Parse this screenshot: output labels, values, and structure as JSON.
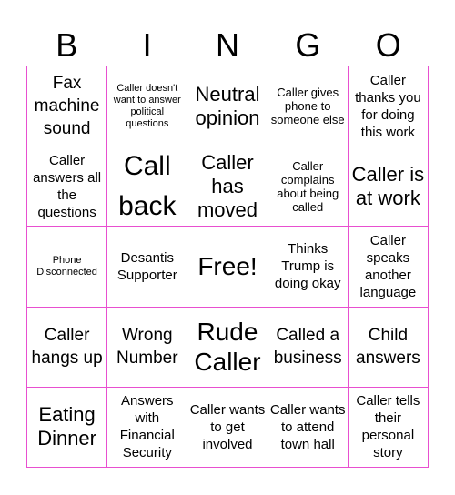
{
  "header": {
    "letters": [
      "B",
      "I",
      "N",
      "G",
      "O"
    ]
  },
  "border_color": "#e84fd0",
  "cells": [
    {
      "text": "Fax machine sound",
      "size": "s-lg"
    },
    {
      "text": "Caller doesn't want to answer political questions",
      "size": "s-xs"
    },
    {
      "text": "Neutral opinion",
      "size": "s-xl"
    },
    {
      "text": "Caller gives phone to someone else",
      "size": "s-sm"
    },
    {
      "text": "Caller thanks you for doing this work",
      "size": "s-md"
    },
    {
      "text": "Caller answers all the questions",
      "size": "s-md"
    },
    {
      "text": "Call back",
      "size": "s-huge"
    },
    {
      "text": "Caller has moved",
      "size": "s-xl"
    },
    {
      "text": "Caller complains about being called",
      "size": "s-sm"
    },
    {
      "text": "Caller is at work",
      "size": "s-xl"
    },
    {
      "text": "Phone Disconnected",
      "size": "s-xs"
    },
    {
      "text": "Desantis Supporter",
      "size": "s-md"
    },
    {
      "text": "Free!",
      "size": "s-xxl"
    },
    {
      "text": "Thinks Trump is doing okay",
      "size": "s-md"
    },
    {
      "text": "Caller speaks another language",
      "size": "s-md"
    },
    {
      "text": "Caller hangs up",
      "size": "s-lg"
    },
    {
      "text": "Wrong Number",
      "size": "s-lg"
    },
    {
      "text": "Rude Caller",
      "size": "s-xxl"
    },
    {
      "text": "Called a business",
      "size": "s-lg"
    },
    {
      "text": "Child answers",
      "size": "s-lg"
    },
    {
      "text": "Eating Dinner",
      "size": "s-xl"
    },
    {
      "text": "Answers with Financial Security",
      "size": "s-md"
    },
    {
      "text": "Caller wants to get involved",
      "size": "s-md"
    },
    {
      "text": "Caller wants to attend town hall",
      "size": "s-md"
    },
    {
      "text": "Caller tells their personal story",
      "size": "s-md"
    }
  ]
}
